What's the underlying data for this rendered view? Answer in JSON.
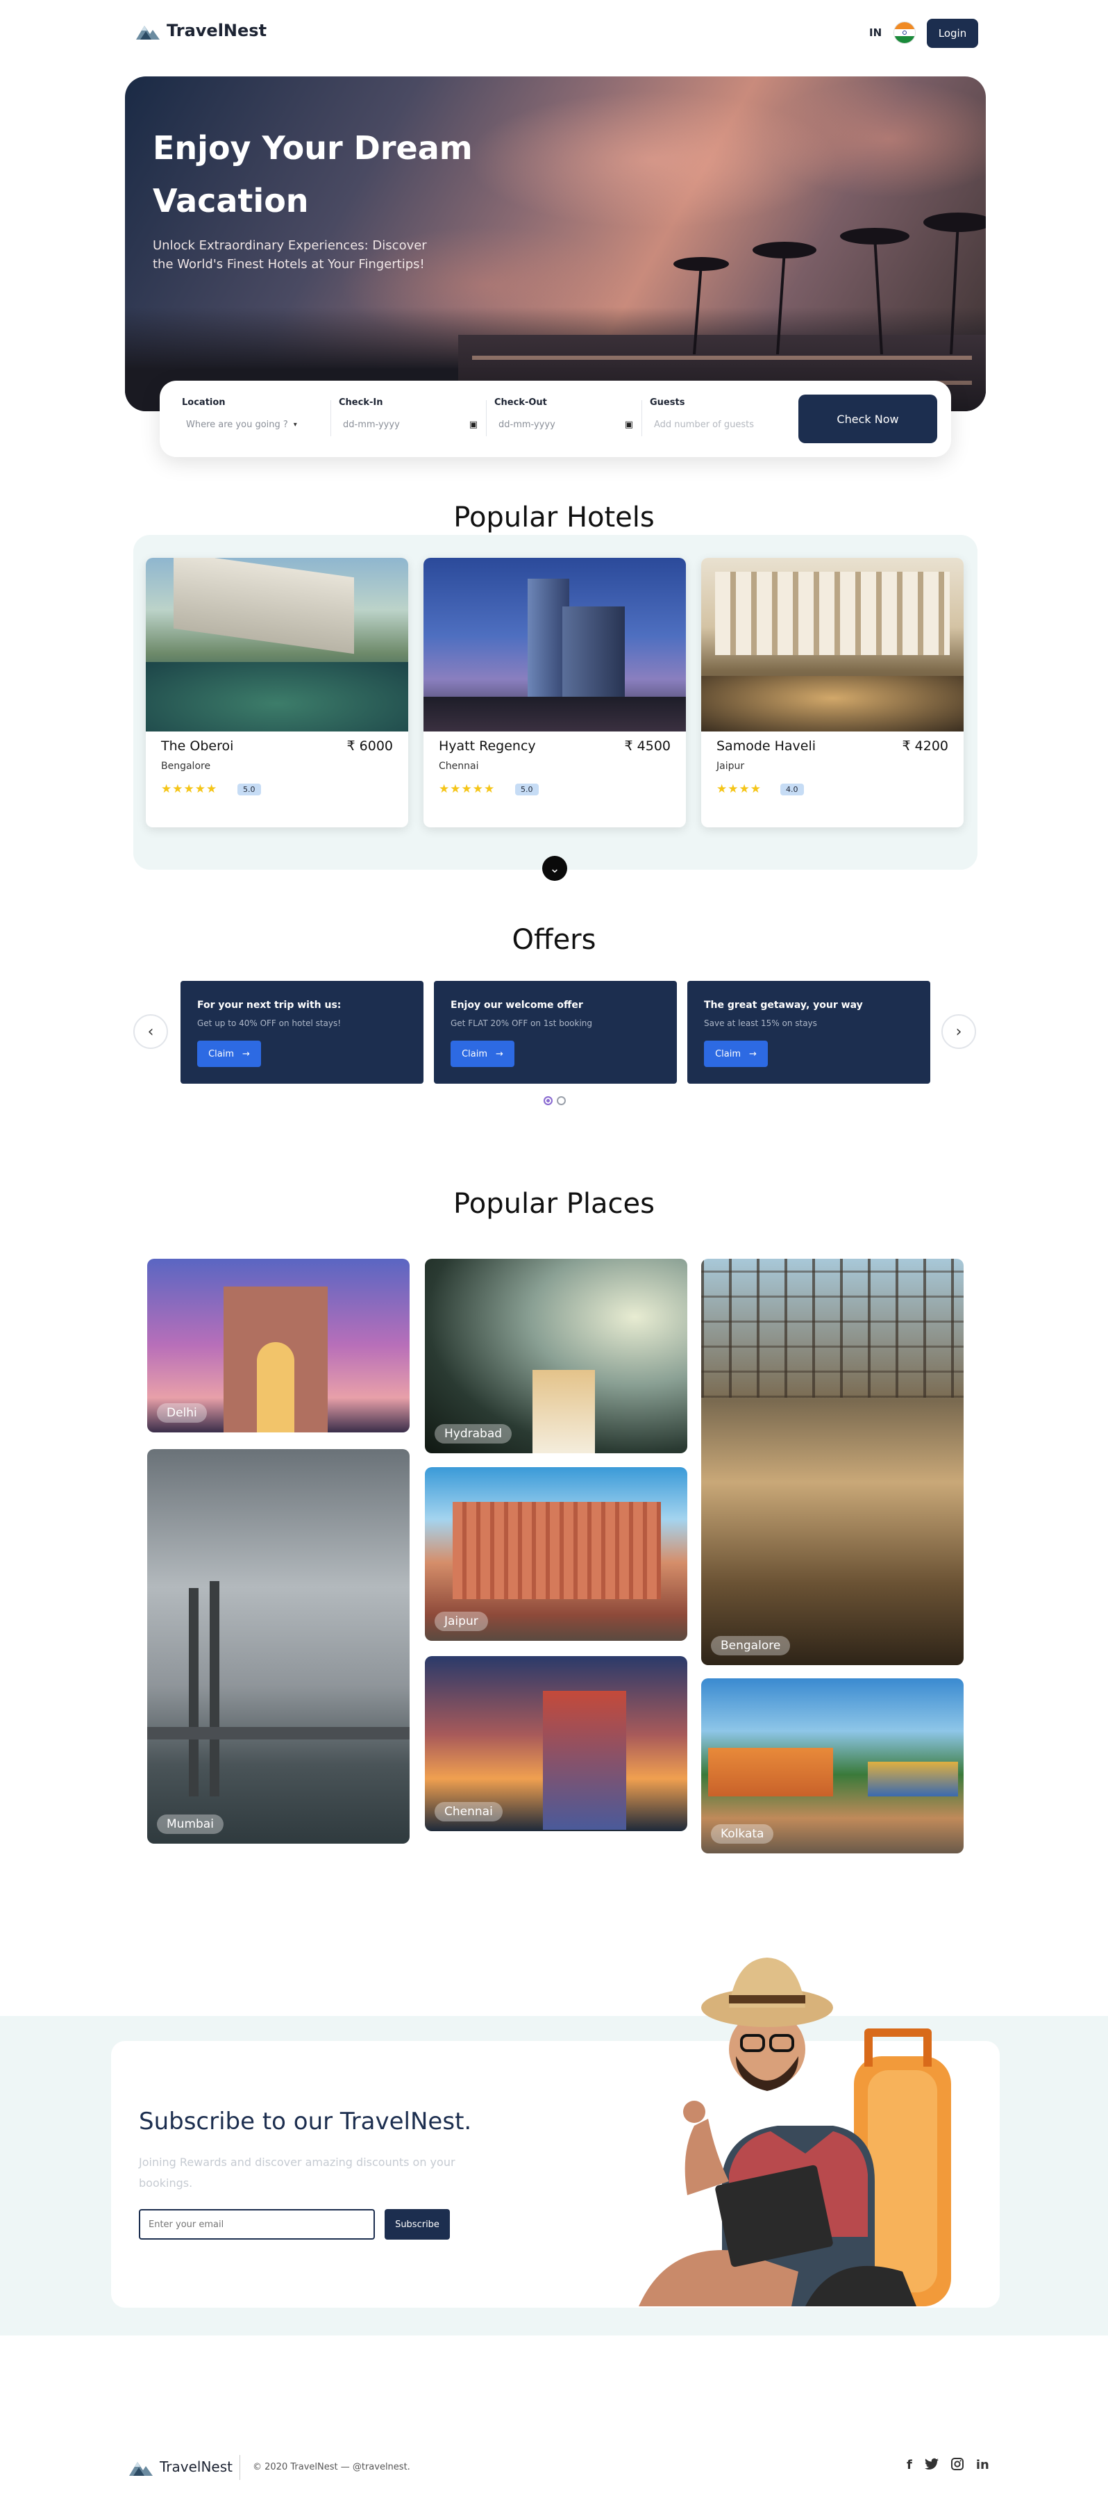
{
  "header": {
    "logo_text": "TravelNest",
    "lang_code": "IN",
    "login_label": "Login"
  },
  "hero": {
    "title": "Enjoy Your Dream Vacation",
    "subtitle": "Unlock Extraordinary Experiences: Discover the World's Finest Hotels at Your Fingertips!"
  },
  "search": {
    "location_label": "Location",
    "location_value": "Where are you going ?",
    "checkin_label": "Check-In",
    "checkin_value": "dd-mm-yyyy",
    "checkout_label": "Check-Out",
    "checkout_value": "dd-mm-yyyy",
    "guests_label": "Guests",
    "guests_placeholder": "Add number of guests",
    "button_label": "Check Now"
  },
  "hotels": {
    "title": "Popular Hotels",
    "items": [
      {
        "name": "The Oberoi",
        "city": "Bengalore",
        "price": "₹ 6000",
        "stars": "★★★★★",
        "rating": "5.0"
      },
      {
        "name": "Hyatt Regency",
        "city": "Chennai",
        "price": "₹ 4500",
        "stars": "★★★★★",
        "rating": "5.0"
      },
      {
        "name": "Samode Haveli",
        "city": "Jaipur",
        "price": "₹ 4200",
        "stars": "★★★★",
        "rating": "4.0"
      }
    ]
  },
  "offers": {
    "title": "Offers",
    "items": [
      {
        "title": "For your next trip with us:",
        "subtitle": "Get up to 40% OFF on hotel stays!",
        "claim": "Claim"
      },
      {
        "title": "Enjoy our welcome offer",
        "subtitle": "Get FLAT 20% OFF on 1st booking",
        "claim": "Claim"
      },
      {
        "title": "The great getaway, your way",
        "subtitle": "Save at least 15% on stays",
        "claim": "Claim"
      }
    ],
    "prev_icon": "chevron-left-icon",
    "next_icon": "chevron-right-icon"
  },
  "places": {
    "title": "Popular Places",
    "items": [
      "Delhi",
      "Hydrabad",
      "Jaipur",
      "Chennai",
      "Mumbai",
      "Bengalore",
      "Kolkata"
    ]
  },
  "subscribe": {
    "title": "Subscribe to our TravelNest.",
    "description": "Joining Rewards and discover amazing discounts on your bookings.",
    "email_placeholder": "Enter your email",
    "button_label": "Subscribe"
  },
  "footer": {
    "logo_text": "TravelNest",
    "copyright": "© 2020 TravelNest — @travelnest.",
    "social": [
      "facebook-icon",
      "twitter-icon",
      "instagram-icon",
      "linkedin-icon"
    ]
  },
  "colors": {
    "primary": "#1c2e4f",
    "accent": "#2d6ae3",
    "light_band": "#eef6f6",
    "star": "#f5c518"
  }
}
